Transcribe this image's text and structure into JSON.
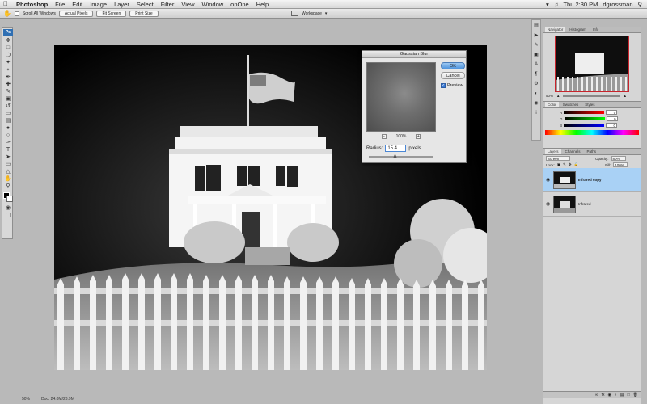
{
  "menubar": {
    "app": "Photoshop",
    "items": [
      "File",
      "Edit",
      "Image",
      "Layer",
      "Select",
      "Filter",
      "View",
      "Window",
      "onOne",
      "Help"
    ],
    "clock": "Thu 2:30 PM",
    "user": "dgrossman"
  },
  "options": {
    "scroll_all_windows": "Scroll All Windows",
    "buttons": [
      "Actual Pixels",
      "Fit Screen",
      "Print Size"
    ],
    "workspace": "Workspace"
  },
  "dialog": {
    "title": "Gaussian Blur",
    "ok": "OK",
    "cancel": "Cancel",
    "preview": "Preview",
    "zoom": "100%",
    "radius_label": "Radius:",
    "radius_value": "15.4",
    "radius_unit": "pixels"
  },
  "status": {
    "zoom": "50%",
    "doc": "Doc: 24.0M/23.9M"
  },
  "navigator": {
    "tabs": [
      "Navigator",
      "Histogram",
      "Info"
    ],
    "zoom": "50%"
  },
  "color_panel": {
    "tabs": [
      "Color",
      "Swatches",
      "Styles"
    ],
    "channels": [
      {
        "label": "R",
        "value": "0"
      },
      {
        "label": "G",
        "value": "0"
      },
      {
        "label": "B",
        "value": "0"
      }
    ]
  },
  "layers_panel": {
    "tabs": [
      "Layers",
      "Channels",
      "Paths"
    ],
    "blend_mode": "Screen",
    "opacity_label": "Opacity:",
    "opacity": "80%",
    "lock_label": "Lock:",
    "fill_label": "Fill:",
    "fill": "100%",
    "layers": [
      {
        "name": "Infrared copy",
        "active": true
      },
      {
        "name": "Infrared",
        "active": false
      }
    ]
  }
}
